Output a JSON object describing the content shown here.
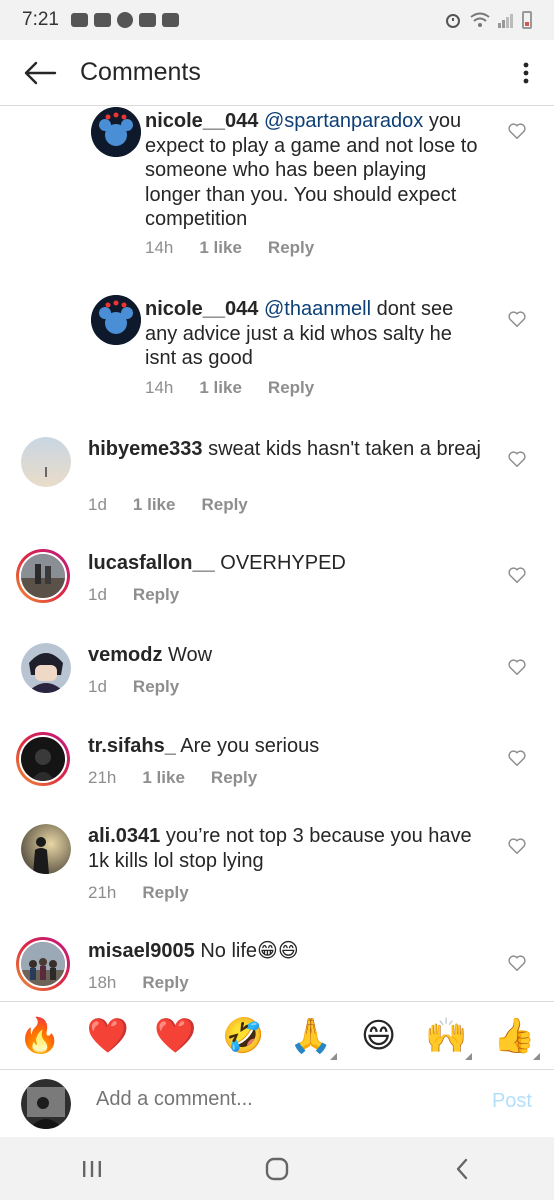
{
  "status_bar": {
    "time": "7:21",
    "left_icons": [
      "discord-icon",
      "youtube-icon",
      "messenger-icon",
      "twitch-icon",
      "gallery-icon"
    ],
    "right_icons": [
      "alarm-icon",
      "wifi-icon",
      "signal-icon",
      "battery-icon"
    ],
    "battery_color": "#d9534f"
  },
  "header": {
    "back_icon": "arrow-left-icon",
    "title": "Comments",
    "more_icon": "more-vertical-icon"
  },
  "comments": [
    {
      "username": "nicole__044",
      "mention": "@spartanparadox",
      "text": " you expect to play a game and not lose to someone who has been playing longer than you. You should expect competition",
      "time": "14h",
      "likes": "1 like",
      "reply": "Reply",
      "is_reply": true,
      "has_story": false
    },
    {
      "username": "nicole__044",
      "mention": "@thaanmell",
      "text": " dont see any advice just a kid whos salty he isnt as good",
      "time": "14h",
      "likes": "1 like",
      "reply": "Reply",
      "is_reply": true,
      "has_story": false
    },
    {
      "username": "hibyeme333",
      "mention": "",
      "text": " sweat kids hasn't taken a breaj",
      "time": "1d",
      "likes": "1 like",
      "reply": "Reply",
      "is_reply": false,
      "has_story": false
    },
    {
      "username": "lucasfallon__",
      "mention": "",
      "text": " OVERHYPED",
      "time": "1d",
      "likes": "",
      "reply": "Reply",
      "is_reply": false,
      "has_story": true
    },
    {
      "username": "vemodz",
      "mention": "",
      "text": " Wow",
      "time": "1d",
      "likes": "",
      "reply": "Reply",
      "is_reply": false,
      "has_story": false
    },
    {
      "username": "tr.sifahs_",
      "mention": "",
      "text": " Are you serious",
      "time": "21h",
      "likes": "1 like",
      "reply": "Reply",
      "is_reply": false,
      "has_story": true
    },
    {
      "username": "ali.0341",
      "mention": "",
      "text": " you’re not top 3 because you have 1k kills lol stop lying",
      "time": "21h",
      "likes": "",
      "reply": "Reply",
      "is_reply": false,
      "has_story": false
    },
    {
      "username": "misael9005",
      "mention": "",
      "text": " No life😁😄",
      "time": "18h",
      "likes": "",
      "reply": "Reply",
      "is_reply": false,
      "has_story": true
    }
  ],
  "emoji_bar": [
    "🔥",
    "❤️",
    "❤️",
    "🤣",
    "🙏",
    "😄",
    "🙌",
    "👍"
  ],
  "add_comment": {
    "placeholder": "Add a comment...",
    "post_label": "Post",
    "post_color": "#b2dffc"
  },
  "nav_bar": {
    "icons": [
      "recent-apps-icon",
      "home-icon",
      "back-icon"
    ]
  },
  "colors": {
    "mention": "#0d3f75",
    "meta_text": "#8e8e8e",
    "divider": "#dbdbdb"
  }
}
